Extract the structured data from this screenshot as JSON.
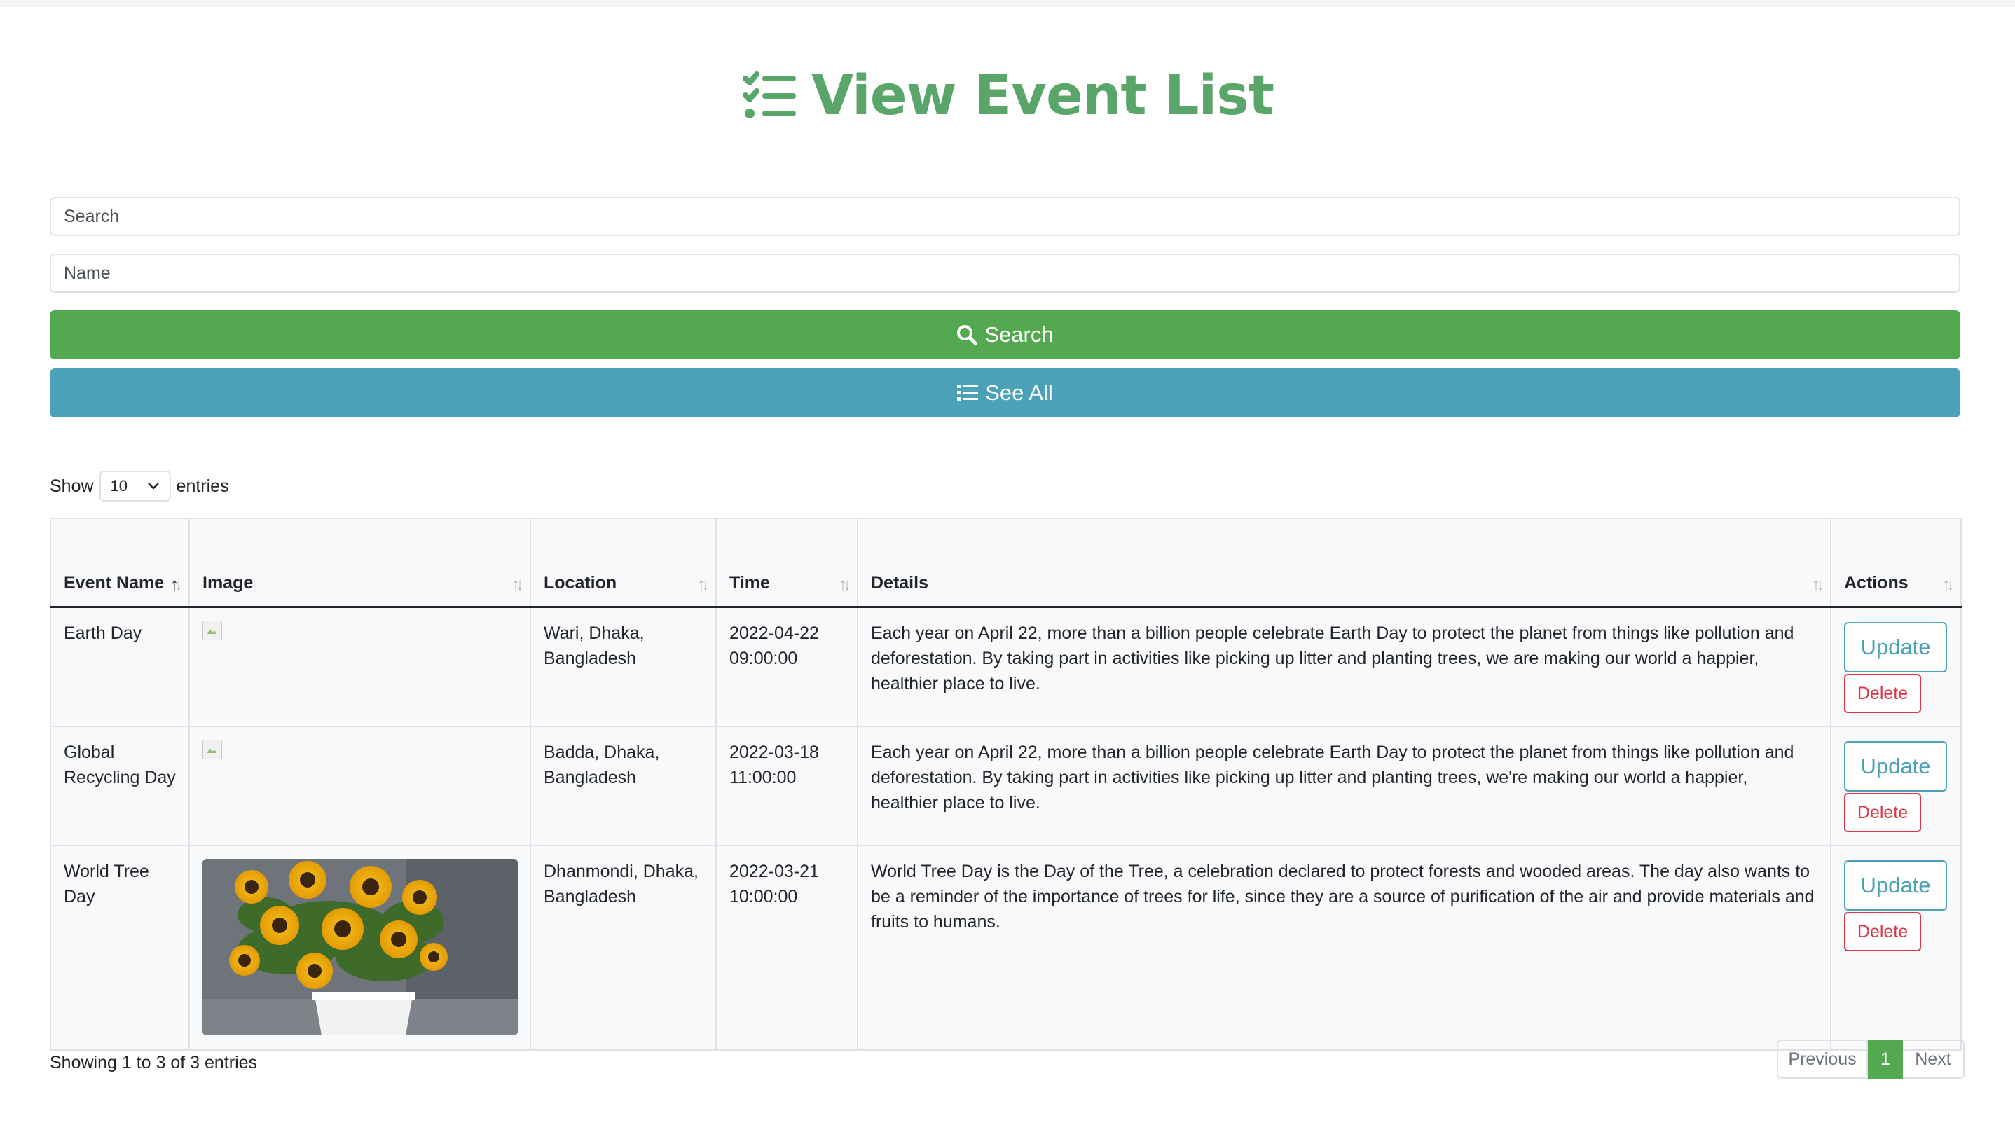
{
  "header": {
    "title": "View Event List",
    "icon": "list-check-icon"
  },
  "search": {
    "search_placeholder": "Search",
    "name_placeholder": "Name"
  },
  "buttons": {
    "search_label": "Search",
    "see_all_label": "See All"
  },
  "length": {
    "show_label": "Show",
    "value": "10",
    "entries_label": "entries"
  },
  "table": {
    "headers": [
      "Event Name",
      "Image",
      "Location",
      "Time",
      "Details",
      "Actions"
    ],
    "rows": [
      {
        "name": "Earth Day",
        "location": "Wari, Dhaka, Bangladesh",
        "time": "2022-04-22 09:00:00",
        "details": "Each year on April 22, more than a billion people celebrate Earth Day to protect the planet from things like pollution and deforestation. By taking part in activities like picking up litter and planting trees, we are making our world a happier, healthier place to live.",
        "update_label": "Update",
        "delete_label": "Delete"
      },
      {
        "name": "Global Recycling Day",
        "location": "Badda, Dhaka, Bangladesh",
        "time": "2022-03-18 11:00:00",
        "details": "Each year on April 22, more than a billion people celebrate Earth Day to protect the planet from things like pollution and deforestation. By taking part in activities like picking up litter and planting trees, we're making our world a happier, healthier place to live.",
        "update_label": "Update",
        "delete_label": "Delete"
      },
      {
        "name": "World Tree Day",
        "location": "Dhanmondi, Dhaka, Bangladesh",
        "time": "2022-03-21 10:00:00",
        "details": "World Tree Day is the Day of the Tree, a celebration declared to protect forests and wooded areas. The day also wants to be a reminder of the importance of trees for life, since they are a source of purification of the air and provide materials and fruits to humans.",
        "update_label": "Update",
        "delete_label": "Delete"
      }
    ]
  },
  "footer": {
    "info": "Showing 1 to 3 of 3 entries",
    "previous": "Previous",
    "current_page": "1",
    "next": "Next"
  },
  "colors": {
    "primary_green": "#54a84f",
    "title_green": "#5aa56a",
    "info_blue": "#4ba1b8",
    "danger_red": "#dc3545"
  }
}
